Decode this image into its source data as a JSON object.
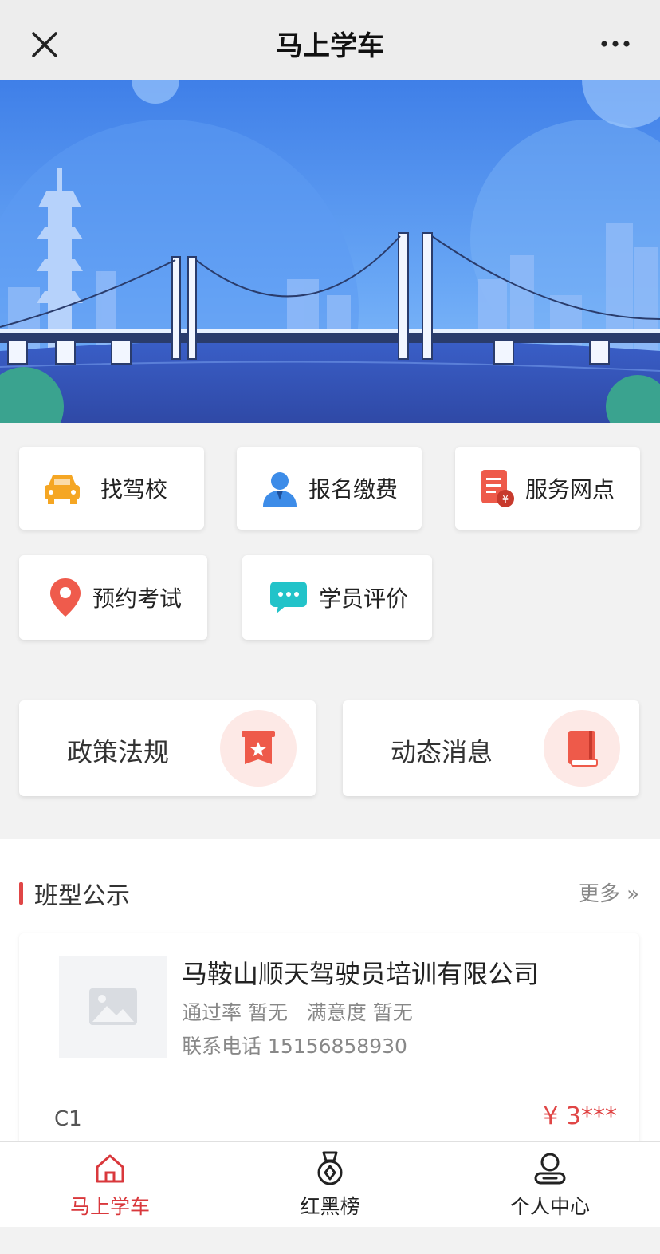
{
  "header": {
    "title": "马上学车",
    "close_icon": "close-icon",
    "more_icon": "more-horizontal-icon"
  },
  "banner": {
    "theme_color": "#4a8ff0",
    "illustration": "city-bridge-illustration"
  },
  "quick_actions": [
    {
      "label": "找驾校",
      "icon": "car-icon",
      "color": "#f5a623"
    },
    {
      "label": "报名缴费",
      "icon": "person-icon",
      "color": "#3d8ce8"
    },
    {
      "label": "服务网点",
      "icon": "bill-icon",
      "color": "#ee5a4a"
    },
    {
      "label": "预约考试",
      "icon": "location-pin-icon",
      "color": "#ef5b4c"
    },
    {
      "label": "学员评价",
      "icon": "chat-bubble-icon",
      "color": "#22c3c9"
    }
  ],
  "feature_cards": [
    {
      "label": "政策法规",
      "icon": "scroll-banner-icon"
    },
    {
      "label": "动态消息",
      "icon": "book-icon"
    }
  ],
  "section": {
    "title": "班型公示",
    "more_label": "更多 »",
    "card": {
      "name": "马鞍山顺天驾驶员培训有限公司",
      "stats": "通过率 暂无   满意度 暂无",
      "phone": "联系电话 15156858930",
      "class": "C1",
      "price": "¥ 3***"
    }
  },
  "tabbar": [
    {
      "label": "马上学车",
      "icon": "home-icon",
      "active": true
    },
    {
      "label": "红黑榜",
      "icon": "medal-icon",
      "active": false
    },
    {
      "label": "个人中心",
      "icon": "user-icon",
      "active": false
    }
  ],
  "colors": {
    "accent": "#d9383c",
    "background": "#f2f2f2"
  }
}
